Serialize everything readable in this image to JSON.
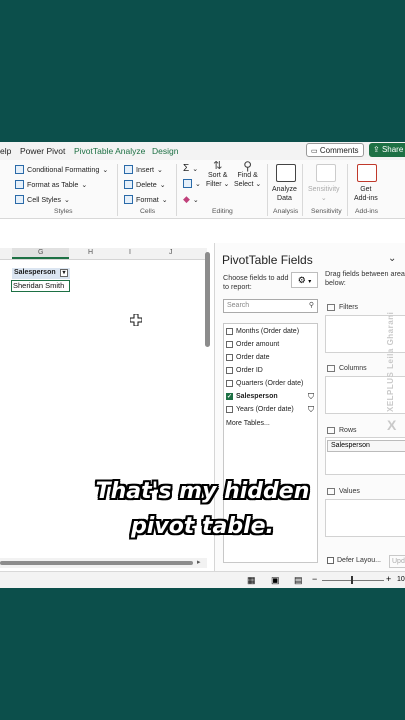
{
  "tabs": {
    "partial": "elp",
    "power_pivot": "Power Pivot",
    "pivot_analyze": "PivotTable Analyze",
    "design": "Design",
    "comments": "Comments",
    "share": "Share"
  },
  "ribbon": {
    "styles": {
      "conditional": "Conditional Formatting",
      "format_table": "Format as Table",
      "cell_styles": "Cell Styles",
      "group": "Styles"
    },
    "cells": {
      "insert": "Insert",
      "delete": "Delete",
      "format": "Format",
      "group": "Cells"
    },
    "editing": {
      "sum": "Σ",
      "sort_1": "Sort &",
      "sort_2": "Filter",
      "find_1": "Find &",
      "find_2": "Select",
      "group": "Editing"
    },
    "analysis": {
      "l1": "Analyze",
      "l2": "Data",
      "group": "Analysis"
    },
    "sensitivity": {
      "label": "Sensitivity",
      "group": "Sensitivity"
    },
    "addins": {
      "l1": "Get",
      "l2": "Add-ins",
      "group": "Add-ins"
    }
  },
  "sheet": {
    "columns": [
      "G",
      "H",
      "I",
      "J"
    ],
    "pivot_header": "Salesperson",
    "pivot_value": "Sheridan Smith"
  },
  "pane": {
    "title": "PivotTable Fields",
    "choose": "Choose fields to add to report:",
    "search_placeholder": "Search",
    "fields": [
      {
        "label": "Months (Order date)",
        "checked": false
      },
      {
        "label": "Order amount",
        "checked": false
      },
      {
        "label": "Order date",
        "checked": false
      },
      {
        "label": "Order ID",
        "checked": false
      },
      {
        "label": "Quarters (Order date)",
        "checked": false
      },
      {
        "label": "Salesperson",
        "checked": true
      },
      {
        "label": "Years (Order date)",
        "checked": false
      }
    ],
    "more_tables": "More Tables...",
    "drag_hint": "Drag fields between areas below:",
    "areas": {
      "filters": "Filters",
      "columns": "Columns",
      "rows": "Rows",
      "values": "Values"
    },
    "row_item": "Salesperson",
    "defer": "Defer Layou...",
    "update": "Upd"
  },
  "watermark": {
    "text": "XELPLUS Leila Gharani",
    "logo": "X"
  },
  "status": {
    "zoom": "10"
  },
  "caption": {
    "line1": "That's my hidden",
    "line2": "pivot table."
  },
  "colors": {
    "excel_green": "#1d7044",
    "background": "#0c4f4b"
  }
}
